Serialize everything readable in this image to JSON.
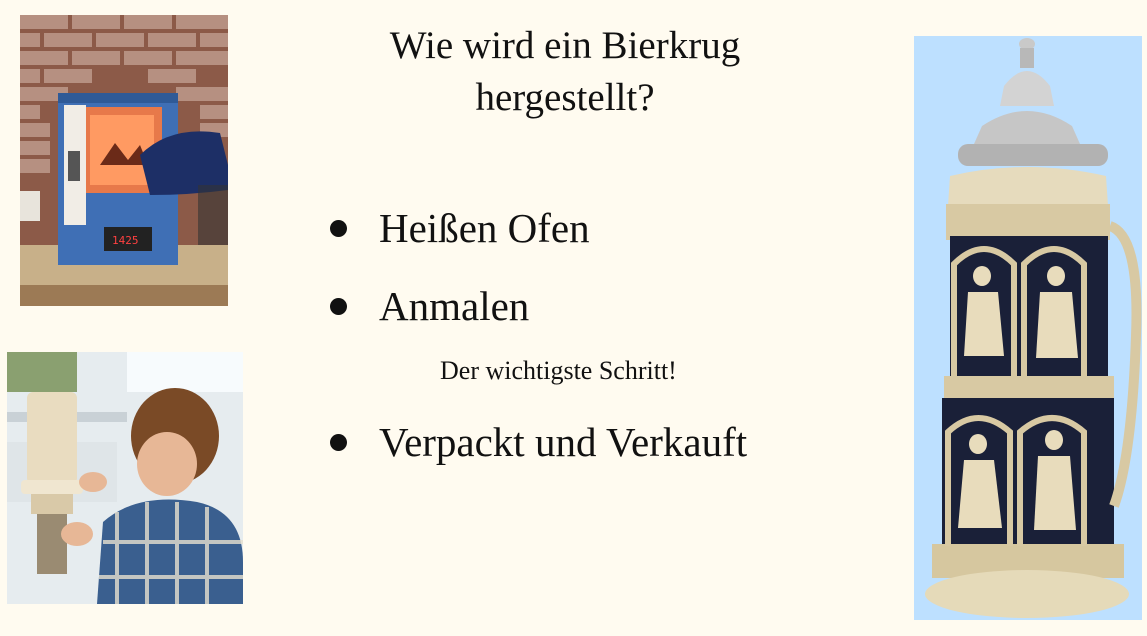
{
  "slide": {
    "title": "Wie wird ein Bierkrug hergestellt?",
    "bullets": [
      {
        "label": "Heißen Ofen"
      },
      {
        "label": "Anmalen"
      },
      {
        "label": "Verpackt und Verkauft"
      }
    ],
    "note": "Der wichtigste Schritt!"
  },
  "images": {
    "kiln": "kiln-photo",
    "painter": "painter-photo",
    "stein": "beer-stein-photo"
  }
}
